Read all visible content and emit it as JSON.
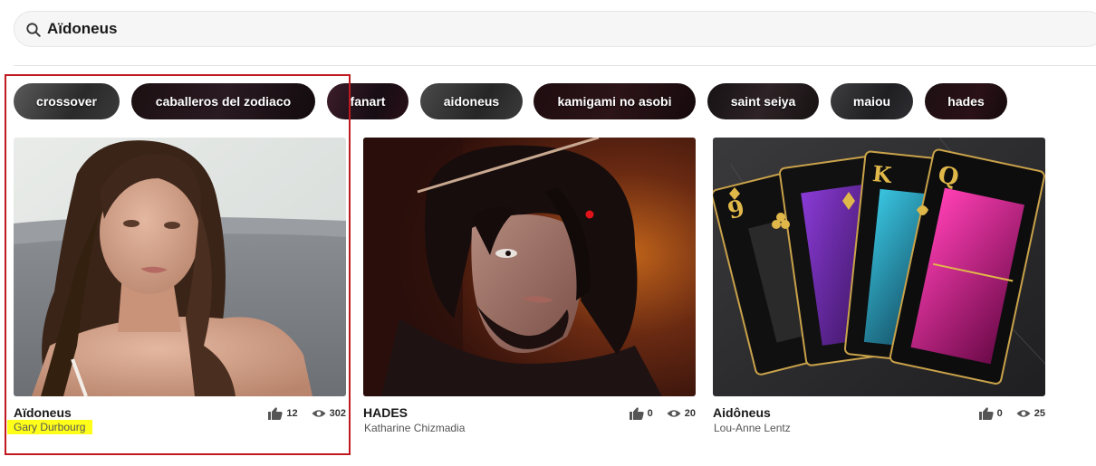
{
  "search": {
    "value": "Aïdoneus",
    "placeholder": ""
  },
  "tags": [
    {
      "label": "crossover"
    },
    {
      "label": "caballeros del zodiaco"
    },
    {
      "label": "fanart"
    },
    {
      "label": "aidoneus"
    },
    {
      "label": "kamigami no asobi"
    },
    {
      "label": "saint seiya"
    },
    {
      "label": "maiou"
    },
    {
      "label": "hades"
    }
  ],
  "cards": [
    {
      "title": "Aïdoneus",
      "author": "Gary Durbourg",
      "likes": "12",
      "views": "302",
      "image": "portrait of a woman with long dark hair on a grey couch"
    },
    {
      "title": "HADES",
      "author": "Katharine Chizmadia",
      "likes": "0",
      "views": "20",
      "image": "painted bearded man with dark hair and a red eye"
    },
    {
      "title": "Aidôneus",
      "author": "Lou-Anne Lentz",
      "likes": "0",
      "views": "25",
      "image": "fan of dark playing cards with gold suits"
    }
  ],
  "icons": {
    "search": "search-icon",
    "like": "thumbs-up-icon",
    "views": "eye-icon"
  },
  "colors": {
    "highlight_box": "#c0191f",
    "author_highlight": "#ffff1a"
  }
}
